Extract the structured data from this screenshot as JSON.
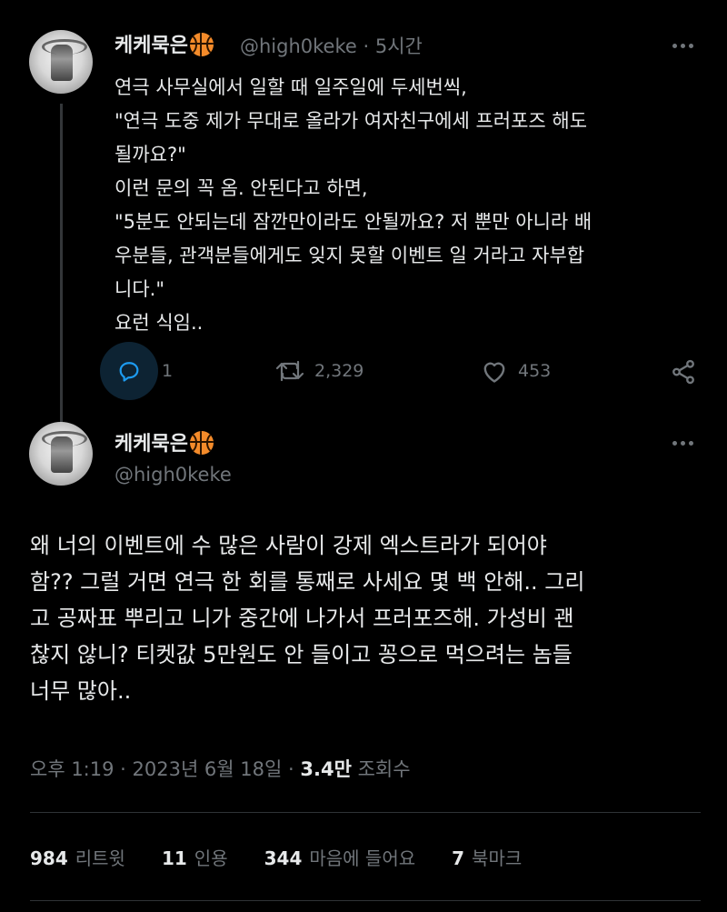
{
  "tweet1": {
    "display_name": "케케묵은",
    "handle": "@high0keke",
    "separator": "·",
    "time": "5시간",
    "lines": [
      "연극 사무실에서 일할 때 일주일에 두세번씩,",
      "\"연극 도중 제가 무대로 올라가 여자친구에세 프러포즈 해도",
      "될까요?\"",
      "이런 문의 꼭 옴. 안된다고 하면,",
      "\"5분도 안되는데 잠깐만이라도 안될까요? 저 뿐만 아니라 배",
      "우분들, 관객분들에게도 잊지 못할 이벤트 일 거라고 자부합",
      "니다.\"",
      "요런 식임.."
    ],
    "replies": "1",
    "retweets": "2,329",
    "likes": "453"
  },
  "tweet2": {
    "display_name": "케케묵은",
    "handle": "@high0keke",
    "lines": [
      "왜 너의 이벤트에 수 많은 사람이 강제 엑스트라가 되어야",
      "함?? 그럴 거면 연극 한 회를 통째로 사세요 몇 백 안해.. 그리",
      "고 공짜표 뿌리고 니가 중간에 나가서 프러포즈해. 가성비 괜",
      "찮지 않니? 티켓값 5만원도 안 들이고 꽁으로 먹으려는 놈들",
      "너무 많아.."
    ],
    "timestamp": "오후 1:19 · 2023년 6월 18일 · ",
    "views_count": "3.4만",
    "views_label": "조회수",
    "stats": {
      "retweets_count": "984",
      "retweets_label": "리트윗",
      "quotes_count": "11",
      "quotes_label": "인용",
      "likes_count": "344",
      "likes_label": "마음에 들어요",
      "bookmarks_count": "7",
      "bookmarks_label": "북마크"
    }
  },
  "colors": {
    "background": "#000000",
    "text": "#e7e9ea",
    "muted": "#71767b",
    "divider": "#2f3336",
    "reply_highlight": "#0d2333",
    "emoji_basketball": "#f48b2a"
  },
  "icons": [
    "basketball-emoji-icon",
    "more-icon",
    "reply-icon",
    "retweet-icon",
    "like-icon",
    "share-icon"
  ]
}
